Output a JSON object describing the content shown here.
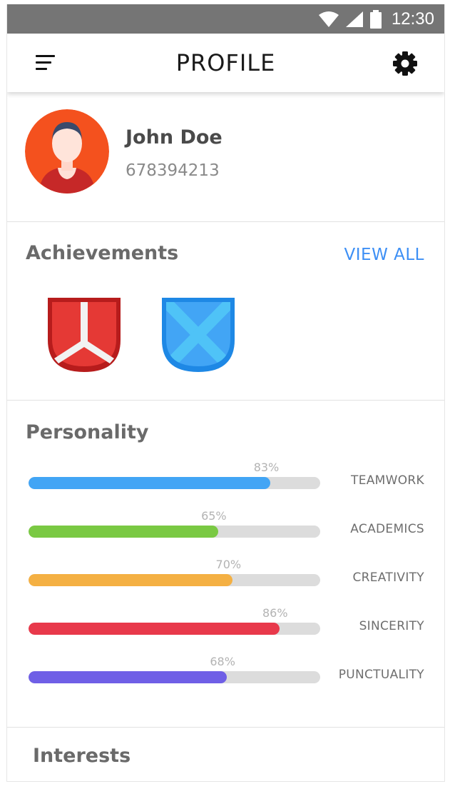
{
  "status_bar": {
    "time": "12:30",
    "icons": [
      "wifi-icon",
      "signal-icon",
      "battery-icon"
    ]
  },
  "app_bar": {
    "title": "PROFILE",
    "menu_icon": "menu-icon",
    "settings_icon": "gear-icon"
  },
  "profile": {
    "name": "John Doe",
    "id": "678394213",
    "avatar_color": "#f4511e"
  },
  "achievements": {
    "title": "Achievements",
    "view_all_label": "VIEW ALL",
    "badges": [
      {
        "icon": "red-shield-badge-icon",
        "color": "#e53935"
      },
      {
        "icon": "blue-shield-badge-icon",
        "color": "#42a5f5"
      }
    ]
  },
  "personality": {
    "title": "Personality",
    "traits": [
      {
        "label": "TEAMWORK",
        "percent_text": "83%",
        "value": 83,
        "color": "#42a5f5"
      },
      {
        "label": "ACADEMICS",
        "percent_text": "65%",
        "value": 65,
        "color": "#7ac943"
      },
      {
        "label": "CREATIVITY",
        "percent_text": "70%",
        "value": 70,
        "color": "#f4b043"
      },
      {
        "label": "SINCERITY",
        "percent_text": "86%",
        "value": 86,
        "color": "#e8394b"
      },
      {
        "label": "PUNCTUALITY",
        "percent_text": "68%",
        "value": 68,
        "color": "#6f5fe6"
      }
    ]
  },
  "interests": {
    "title": "Interests"
  },
  "colors": {
    "accent": "#3d8ff5",
    "status_bar": "#757575"
  }
}
